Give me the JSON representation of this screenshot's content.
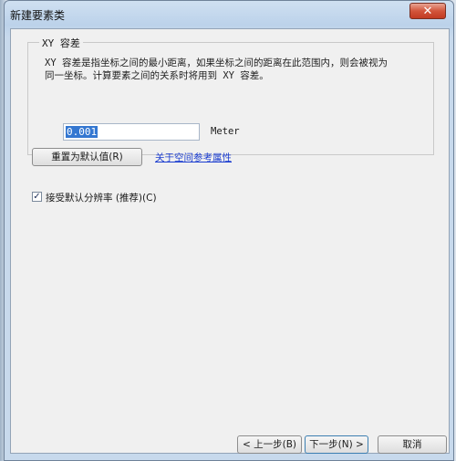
{
  "window": {
    "title": "新建要素类",
    "close_glyph": "✕"
  },
  "xy_tolerance": {
    "group_title": "XY 容差",
    "description_line1": "XY 容差是指坐标之间的最小距离，如果坐标之间的距离在此范围内，则会被视为",
    "description_line2": "同一坐标。计算要素之间的关系时将用到 XY 容差。",
    "value": "0.001",
    "unit": "Meter"
  },
  "actions": {
    "reset_label": "重置为默认值(R)",
    "spatial_ref_link": "关于空间参考属性"
  },
  "default_resolution": {
    "checked": true,
    "check_glyph": "✓",
    "label": "接受默认分辨率  (推荐)(C)"
  },
  "footer": {
    "back_label": "< 上一步(B)",
    "next_label": "下一步(N) >",
    "cancel_label": "取消"
  },
  "colors": {
    "link": "#1a3ccf",
    "selection": "#3477d1",
    "close_button": "#c23b22"
  }
}
